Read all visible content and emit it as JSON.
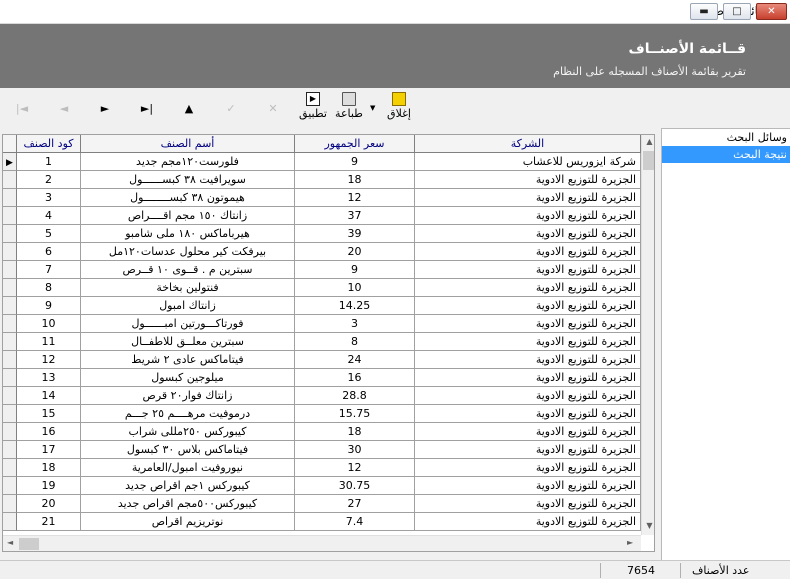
{
  "window": {
    "title": "قائمة الأصناف",
    "app_icon": "app-window-icon",
    "controls": {
      "minimize": "▬",
      "maximize": "□",
      "close": "✕"
    }
  },
  "header": {
    "title": "قــائمة الأصنــاف",
    "subtitle": "تقرير بقائمة الأصناف المسجله على النظام"
  },
  "toolbar": {
    "nav_first": "|◄",
    "nav_prev": "◄",
    "nav_next": "►",
    "nav_last": "►|",
    "nav_up": "▲",
    "nav_check": "✓",
    "nav_cancel": "✕",
    "apply_label": "تطبيق",
    "print_label": "طباعة",
    "close_label": "إغلاق",
    "dropdown_arrow": "▼"
  },
  "sidepanel": {
    "items": [
      {
        "label": "وسائل البحث",
        "active": false
      },
      {
        "label": "نتيجة البحث",
        "active": true
      }
    ]
  },
  "grid": {
    "columns": {
      "code": "كود الصنف",
      "name": "أسم الصنف",
      "price": "سعر الجمهور",
      "company": "الشركة"
    },
    "selected_pointer": "▶",
    "rows": [
      {
        "code": "1",
        "name": "فلورست١٢٠مجم جديد",
        "price": "9",
        "company": "شركة ايزوريس للاعشاب"
      },
      {
        "code": "2",
        "name": "سويرافيت ٣٨ كبســــــول",
        "price": "18",
        "company": "الجزيرة للتوزيع الادوية"
      },
      {
        "code": "3",
        "name": "هيموتون ٣٨ كبســــــــول",
        "price": "12",
        "company": "الجزيرة للتوزيع الادوية"
      },
      {
        "code": "4",
        "name": "زانتاك ١٥٠ مجم اقــــراص",
        "price": "37",
        "company": "الجزيرة للتوزيع الادوية"
      },
      {
        "code": "5",
        "name": "هيرباماكس ١٨٠ ملى شامبو",
        "price": "39",
        "company": "الجزيرة للتوزيع الادوية"
      },
      {
        "code": "6",
        "name": "بيرفكت كير محلول عدسات١٢٠مل",
        "price": "20",
        "company": "الجزيرة للتوزيع الادوية"
      },
      {
        "code": "7",
        "name": "سبترين م . قــوى ١٠ قــرص",
        "price": "9",
        "company": "الجزيرة للتوزيع الادوية"
      },
      {
        "code": "8",
        "name": "فنتولين بخاخة",
        "price": "10",
        "company": "الجزيرة للتوزيع الادوية"
      },
      {
        "code": "9",
        "name": "زانتاك امبول",
        "price": "14.25",
        "company": "الجزيرة للتوزيع الادوية"
      },
      {
        "code": "10",
        "name": "فورتاكـــورتين امبــــــول",
        "price": "3",
        "company": "الجزيرة للتوزيع الادوية"
      },
      {
        "code": "11",
        "name": "سبترين معلــق للاطفــال",
        "price": "8",
        "company": "الجزيرة للتوزيع الادوية"
      },
      {
        "code": "12",
        "name": "فيتاماكس عادى ٢ شريط",
        "price": "24",
        "company": "الجزيرة للتوزيع الادوية"
      },
      {
        "code": "13",
        "name": "ميلوجين كبسول",
        "price": "16",
        "company": "الجزيرة للتوزيع الادوية"
      },
      {
        "code": "14",
        "name": "زانتاك فوار٢٠ قرص",
        "price": "28.8",
        "company": "الجزيرة للتوزيع الادوية"
      },
      {
        "code": "15",
        "name": "درموفيت مرهــــم ٢٥ جـــم",
        "price": "15.75",
        "company": "الجزيرة للتوزيع الادوية"
      },
      {
        "code": "16",
        "name": "كيبوركس ٢٥٠مللى شراب",
        "price": "18",
        "company": "الجزيرة للتوزيع الادوية"
      },
      {
        "code": "17",
        "name": "فيتاماكس بلاس ٣٠ كبسول",
        "price": "30",
        "company": "الجزيرة للتوزيع الادوية"
      },
      {
        "code": "18",
        "name": "نيوروفيت امبول/العامرية",
        "price": "12",
        "company": "الجزيرة للتوزيع الادوية"
      },
      {
        "code": "19",
        "name": "كيبوركس ١جم اقراص جديد",
        "price": "30.75",
        "company": "الجزيرة للتوزيع الادوية"
      },
      {
        "code": "20",
        "name": "كيبوركس٥٠٠مجم اقراص جديد",
        "price": "27",
        "company": "الجزيرة للتوزيع الادوية"
      },
      {
        "code": "21",
        "name": "نوتريزيم اقراص",
        "price": "7.4",
        "company": "الجزيرة للتوزيع الادوية"
      }
    ]
  },
  "scrollbar": {
    "up": "▲",
    "down": "▼",
    "left": "◄",
    "right": "►"
  },
  "status": {
    "count_label": "عدد الأصناف",
    "count_value": "7654"
  },
  "colors": {
    "header_bg": "#757575",
    "column_header_text": "#000080",
    "active_item_bg": "#3399ff",
    "close_button": "#c7402d"
  }
}
